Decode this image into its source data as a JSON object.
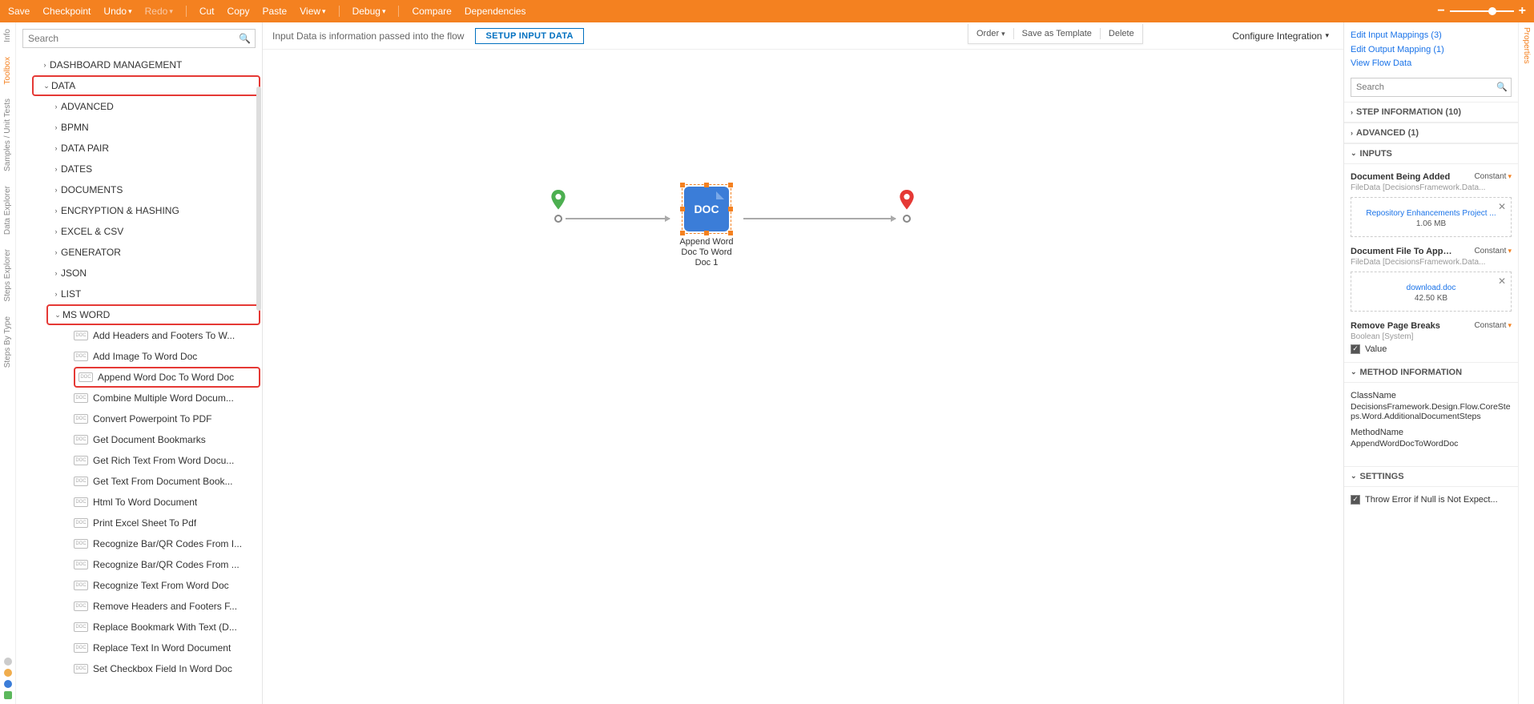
{
  "topbar": {
    "save": "Save",
    "checkpoint": "Checkpoint",
    "undo": "Undo",
    "redo": "Redo",
    "cut": "Cut",
    "copy": "Copy",
    "paste": "Paste",
    "view": "View",
    "debug": "Debug",
    "compare": "Compare",
    "dependencies": "Dependencies"
  },
  "leftrail": {
    "info": "Info",
    "toolbox": "Toolbox",
    "samples": "Samples / Unit Tests",
    "dataexplorer": "Data Explorer",
    "stepsexplorer": "Steps Explorer",
    "stepsbytype": "Steps By Type"
  },
  "toolbox": {
    "search_placeholder": "Search",
    "items": {
      "dashboard": "DASHBOARD MANAGEMENT",
      "data": "DATA",
      "advanced": "ADVANCED",
      "bpmn": "BPMN",
      "datapair": "DATA PAIR",
      "dates": "DATES",
      "documents": "DOCUMENTS",
      "encryption": "ENCRYPTION & HASHING",
      "excel": "EXCEL & CSV",
      "generator": "GENERATOR",
      "json": "JSON",
      "list": "LIST",
      "msword": "MS WORD"
    },
    "leaves": [
      "Add Headers and Footers To W...",
      "Add Image To Word Doc",
      "Append Word Doc To Word Doc",
      "Combine Multiple Word Docum...",
      "Convert Powerpoint To PDF",
      "Get Document Bookmarks",
      "Get Rich Text From Word Docu...",
      "Get Text From Document Book...",
      "Html To Word Document",
      "Print Excel Sheet To Pdf",
      "Recognize Bar/QR Codes From I...",
      "Recognize Bar/QR Codes From ...",
      "Recognize Text From Word Doc",
      "Remove Headers and Footers F...",
      "Replace Bookmark With Text (D...",
      "Replace Text In Word Document",
      "Set Checkbox Field In Word Doc"
    ]
  },
  "canvas": {
    "infotext": "Input Data is information passed into the flow",
    "setup_btn": "SETUP INPUT DATA",
    "configure": "Configure Integration",
    "floating": {
      "order": "Order",
      "save_tpl": "Save as Template",
      "delete": "Delete"
    },
    "docnode": {
      "badge": "DOC",
      "label": "Append Word Doc To Word Doc 1"
    }
  },
  "props": {
    "links": {
      "input_map": "Edit Input Mappings (3)",
      "output_map": "Edit Output Mapping (1)",
      "view_flow": "View Flow Data"
    },
    "search_placeholder": "Search",
    "sections": {
      "stepinfo": "STEP INFORMATION (10)",
      "advanced": "ADVANCED (1)",
      "inputs": "INPUTS",
      "method": "METHOD INFORMATION",
      "settings": "SETTINGS"
    },
    "inputs": {
      "doc_added_label": "Document Being Added",
      "doc_added_type": "FileData [DecisionsFramework.Data...",
      "doc_added_file": "Repository Enhancements Project ...",
      "doc_added_size": "1.06 MB",
      "doc_file_label": "Document File To Appe...",
      "doc_file_type": "FileData [DecisionsFramework.Data...",
      "doc_file_file": "download.doc",
      "doc_file_size": "42.50 KB",
      "remove_breaks": "Remove Page Breaks",
      "remove_breaks_type": "Boolean [System]",
      "value_label": "Value"
    },
    "constant_label": "Constant",
    "method": {
      "class_label": "ClassName",
      "class_value": "DecisionsFramework.Design.Flow.CoreSteps.Word.AdditionalDocumentSteps",
      "method_label": "MethodName",
      "method_value": "AppendWordDocToWordDoc"
    },
    "settings": {
      "throw": "Throw Error if Null is Not Expect..."
    }
  },
  "rightrail": {
    "properties": "Properties"
  }
}
